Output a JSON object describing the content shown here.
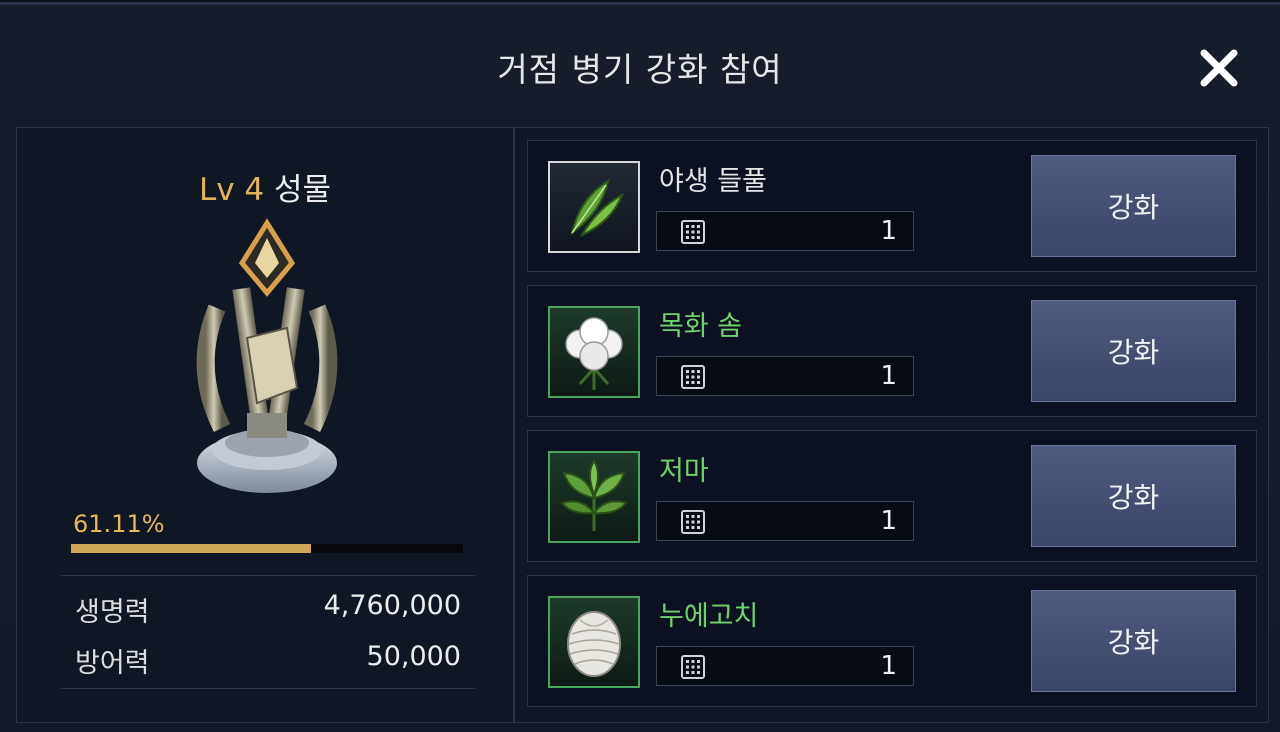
{
  "dialog": {
    "title": "거점 병기 강화 참여",
    "close_icon": "close-icon"
  },
  "relic": {
    "level": "Lv 4",
    "name": "성물",
    "progress_text": "61.11%",
    "progress": 0.6111,
    "stats": [
      {
        "label": "생명력",
        "value": "4,760,000"
      },
      {
        "label": "방어력",
        "value": "50,000"
      }
    ]
  },
  "items": [
    {
      "name": "야생 들풀",
      "quantity": "1",
      "grade": "normal",
      "icon": "wild-grass-icon",
      "button": "강화"
    },
    {
      "name": "목화 솜",
      "quantity": "1",
      "grade": "uncommon",
      "icon": "cotton-icon",
      "button": "강화"
    },
    {
      "name": "저마",
      "quantity": "1",
      "grade": "uncommon",
      "icon": "ramie-leaf-icon",
      "button": "강화"
    },
    {
      "name": "누에고치",
      "quantity": "1",
      "grade": "uncommon",
      "icon": "cocoon-icon",
      "button": "강화"
    }
  ],
  "colors": {
    "accent_gold": "#cfa656",
    "uncommon_green": "#6ed36b",
    "button": "#4f5a7f"
  }
}
